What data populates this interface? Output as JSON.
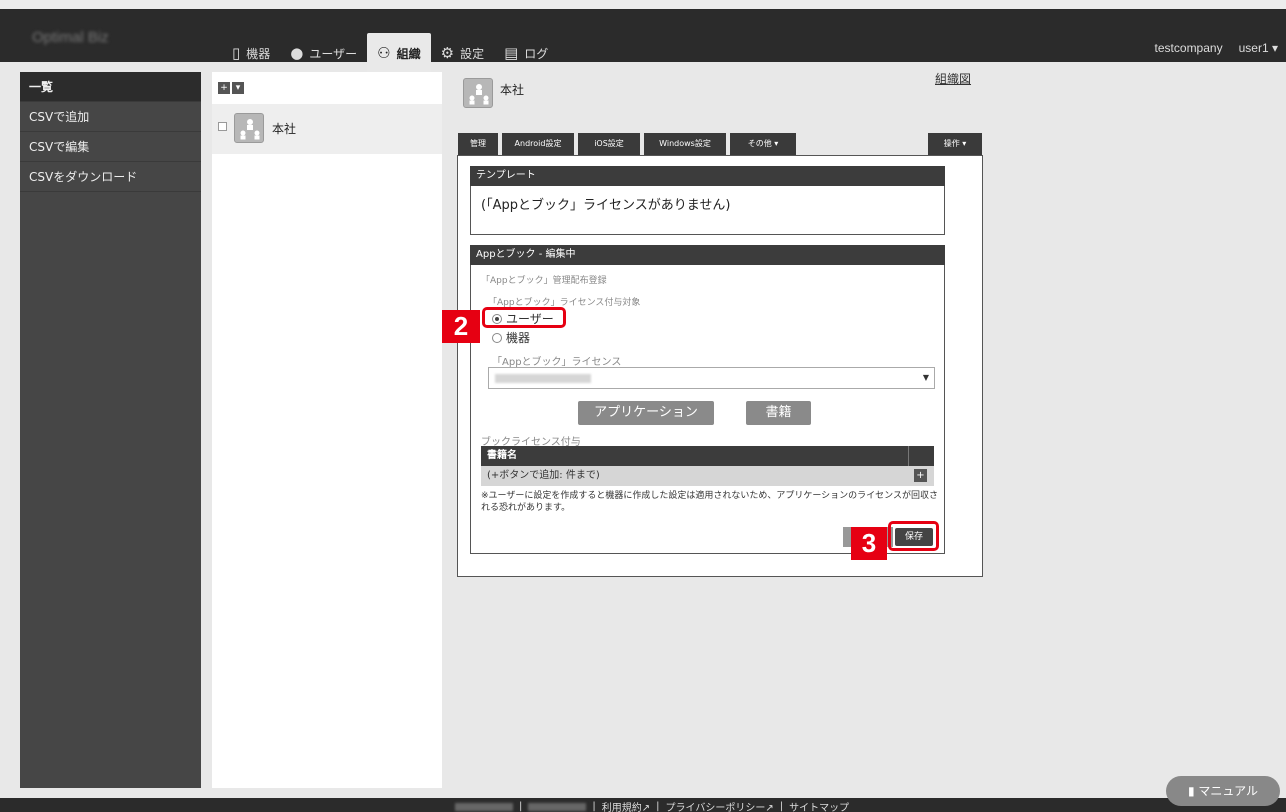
{
  "header": {
    "logo": "Optimal Biz",
    "nav": [
      {
        "label": "機器",
        "icon": "smartphone-icon"
      },
      {
        "label": "ユーザー",
        "icon": "user-icon"
      },
      {
        "label": "組織",
        "icon": "group-icon",
        "active": true
      },
      {
        "label": "設定",
        "icon": "gear-icon"
      },
      {
        "label": "ログ",
        "icon": "document-icon"
      }
    ],
    "company": "testcompany",
    "user": "user1"
  },
  "sidebar": {
    "items": [
      {
        "label": "一覧",
        "active": true
      },
      {
        "label": "CSVで追加"
      },
      {
        "label": "CSVで編集"
      },
      {
        "label": "CSVをダウンロード"
      }
    ]
  },
  "tree": {
    "add_label": "+",
    "menu_label": "▾",
    "node_label": "本社"
  },
  "main": {
    "title": "本社",
    "org_chart_link": "組織図",
    "tabs": [
      "管理",
      "Android設定",
      "iOS設定",
      "Windows設定",
      "その他 ▾"
    ],
    "ops_tab": "操作 ▾"
  },
  "template_card": {
    "title": "テンプレート",
    "text": "(「Appとブック」ライセンスがありません)"
  },
  "app_card": {
    "title": "Appとブック - 編集中",
    "section_label": "「Appとブック」管理配布登録",
    "target_label": "「Appとブック」ライセンス付与対象",
    "radio_user": "ユーザー",
    "radio_device": "機器",
    "license_label": "「Appとブック」ライセンス",
    "app_button": "アプリケーション",
    "book_button": "書籍",
    "book_license_label": "ブックライセンス付与",
    "book_table_header": "書籍名",
    "book_row_text": "(+ボタンで追加: 件まで)",
    "note": "※ユーザーに設定を作成すると機器に作成した設定は適用されないため、アプリケーションのライセンスが回収される恐れがあります。",
    "save_label": "保存"
  },
  "callouts": {
    "step2": "2",
    "step3": "3"
  },
  "footer": {
    "terms": "利用規約",
    "privacy": "プライバシーポリシー",
    "sitemap": "サイトマップ"
  },
  "manual_button": "マニュアル",
  "colors": {
    "highlight": "#e60012",
    "topbar": "#2b2b2b",
    "sidebar": "#464646"
  }
}
